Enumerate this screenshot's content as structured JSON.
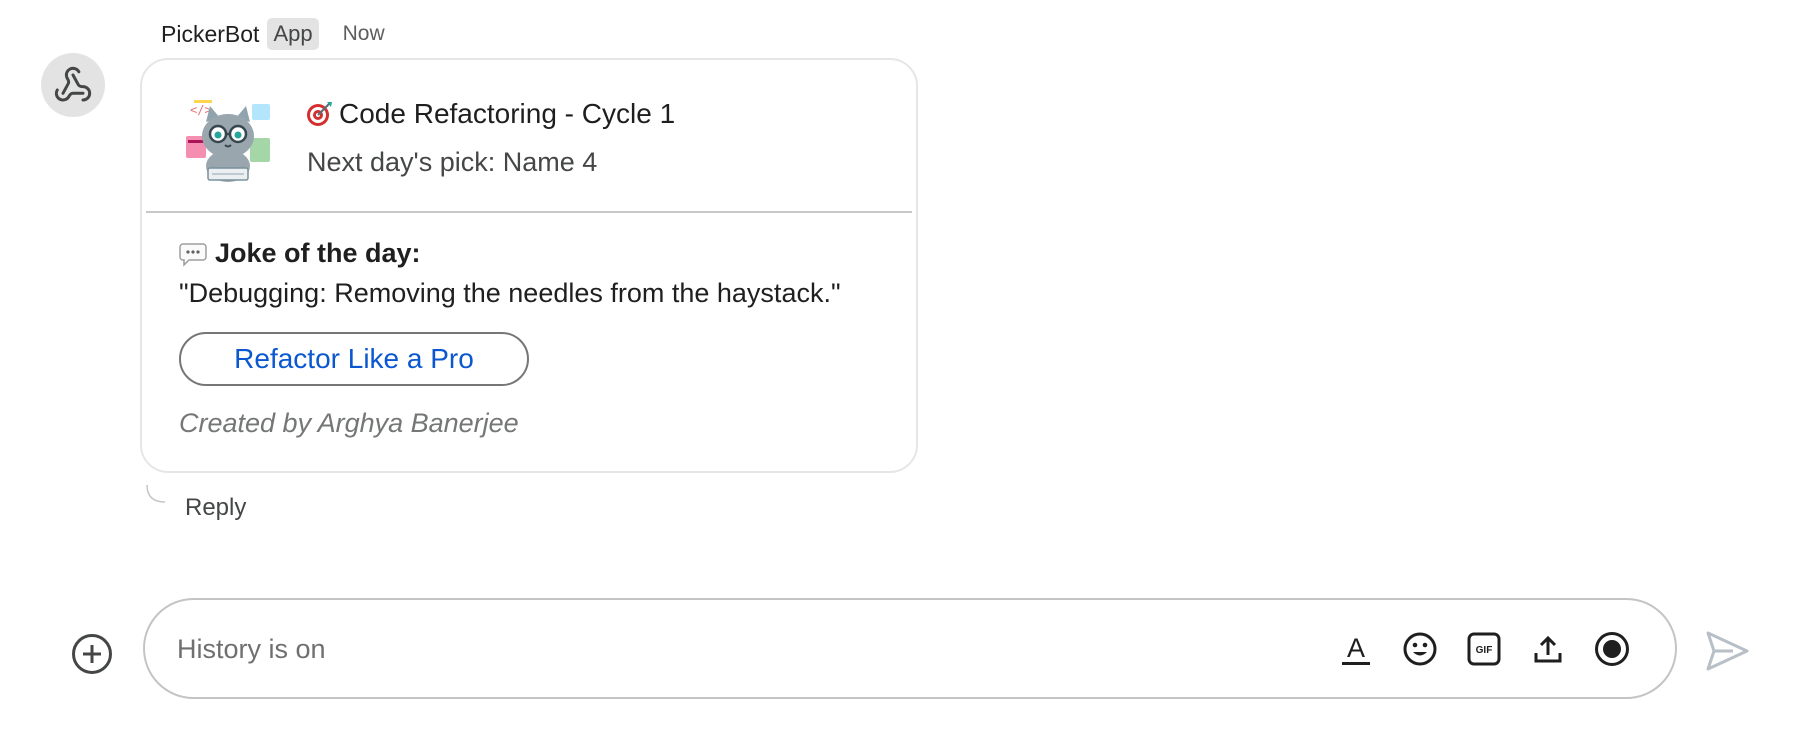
{
  "message": {
    "sender": "PickerBot",
    "badge": "App",
    "time": "Now"
  },
  "card": {
    "title": "Code Refactoring - Cycle 1",
    "subtitle": "Next day's pick: Name 4",
    "joke_heading": "Joke of the day:",
    "joke_text": "\"Debugging: Removing the needles from the haystack.\"",
    "button_label": "Refactor Like a Pro",
    "created_by": "Created by Arghya Banerjee"
  },
  "thread": {
    "reply_label": "Reply"
  },
  "composer": {
    "placeholder": "History is on",
    "tools": [
      "format-text-icon",
      "emoji-icon",
      "gif-icon",
      "upload-icon",
      "record-video-icon"
    ]
  },
  "colors": {
    "link_blue": "#0b57d0",
    "card_border": "#e6e6e6",
    "avatar_bg": "#e3e3e3"
  }
}
